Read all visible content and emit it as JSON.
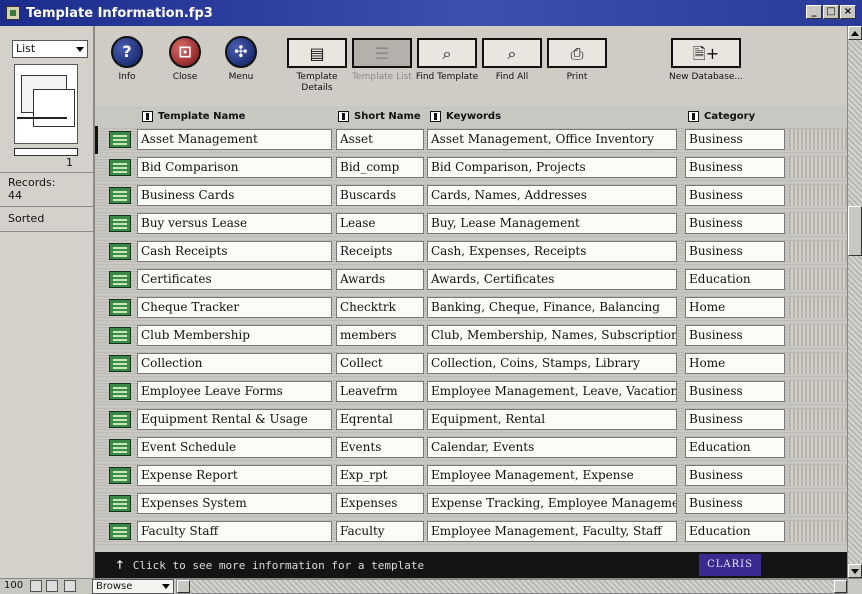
{
  "window": {
    "title": "Template Information.fp3",
    "controls": [
      "minimize",
      "maximize",
      "close"
    ]
  },
  "status_area": {
    "layout_select": "List",
    "record_number": "1",
    "records_label": "Records:",
    "records_count": "44",
    "sort_status": "Sorted"
  },
  "toolbar": {
    "buttons": [
      {
        "label": "Info",
        "icon": "question-icon"
      },
      {
        "label": "Close",
        "icon": "close-door-icon"
      },
      {
        "label": "Menu",
        "icon": "menu-compass-icon"
      },
      {
        "label": "Template Details",
        "icon": "template-details-icon"
      },
      {
        "label": "Template List",
        "icon": "template-list-icon",
        "state": "active-dimmed"
      },
      {
        "label": "Find Template",
        "icon": "find-template-icon"
      },
      {
        "label": "Find All",
        "icon": "find-all-icon"
      },
      {
        "label": "Print",
        "icon": "print-icon"
      },
      {
        "label": "New Database...",
        "icon": "new-database-icon"
      }
    ]
  },
  "columns": {
    "name": "Template Name",
    "short": "Short Name",
    "keywords": "Keywords",
    "category": "Category"
  },
  "rows": [
    {
      "name": "Asset Management",
      "short": "Asset",
      "keywords": "Asset Management, Office Inventory",
      "category": "Business"
    },
    {
      "name": "Bid Comparison",
      "short": "Bid_comp",
      "keywords": "Bid Comparison, Projects",
      "category": "Business"
    },
    {
      "name": "Business Cards",
      "short": "Buscards",
      "keywords": "Cards, Names, Addresses",
      "category": "Business"
    },
    {
      "name": "Buy versus Lease",
      "short": "Lease",
      "keywords": "Buy, Lease Management",
      "category": "Business"
    },
    {
      "name": "Cash Receipts",
      "short": "Receipts",
      "keywords": "Cash, Expenses, Receipts",
      "category": "Business"
    },
    {
      "name": "Certificates",
      "short": "Awards",
      "keywords": "Awards, Certificates",
      "category": "Education"
    },
    {
      "name": "Cheque Tracker",
      "short": "Checktrk",
      "keywords": "Banking, Cheque, Finance, Balancing",
      "category": "Home"
    },
    {
      "name": "Club Membership",
      "short": "members",
      "keywords": "Club, Membership, Names, Subscription",
      "category": "Business"
    },
    {
      "name": "Collection",
      "short": "Collect",
      "keywords": "Collection, Coins, Stamps, Library",
      "category": "Home"
    },
    {
      "name": "Employee Leave Forms",
      "short": "Leavefrm",
      "keywords": "Employee Management, Leave, Vacation",
      "category": "Business"
    },
    {
      "name": "Equipment Rental & Usage",
      "short": "Eqrental",
      "keywords": "Equipment, Rental",
      "category": "Business"
    },
    {
      "name": "Event Schedule",
      "short": "Events",
      "keywords": "Calendar, Events",
      "category": "Education"
    },
    {
      "name": "Expense Report",
      "short": "Exp_rpt",
      "keywords": "Employee Management, Expense",
      "category": "Business"
    },
    {
      "name": "Expenses System",
      "short": "Expenses",
      "keywords": "Expense Tracking, Employee Management",
      "category": "Business"
    },
    {
      "name": "Faculty Staff",
      "short": "Faculty",
      "keywords": "Employee Management, Faculty, Staff",
      "category": "Education"
    }
  ],
  "info_strip": {
    "text": "Click to see more information for a template",
    "brand": "CLARIS"
  },
  "bottom_bar": {
    "zoom": "100",
    "mode": "Browse"
  }
}
